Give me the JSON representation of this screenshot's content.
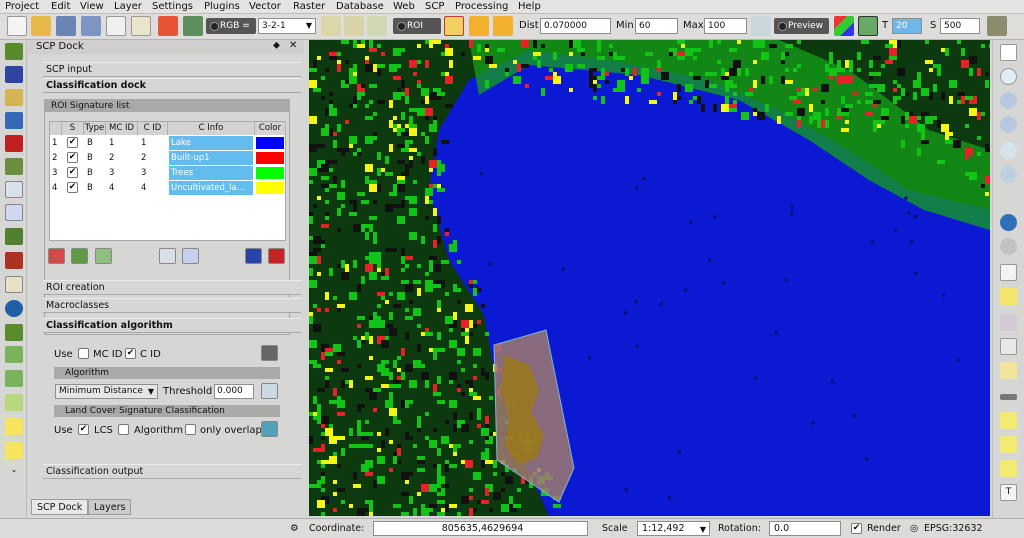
{
  "menu": [
    "Project",
    "Edit",
    "View",
    "Layer",
    "Settings",
    "Plugins",
    "Vector",
    "Raster",
    "Database",
    "Web",
    "SCP",
    "Processing",
    "Help"
  ],
  "toolbar": {
    "rgb_label": "RGB =",
    "rgb_value": "3-2-1",
    "roi_label": "ROI",
    "dist_label": "Dist",
    "dist_value": "0.070000",
    "min_label": "Min",
    "min_value": "60",
    "max_label": "Max",
    "max_value": "100",
    "preview_label": "Preview",
    "t_label": "T",
    "t_value": "20",
    "s_label": "S",
    "s_value": "500"
  },
  "dock": {
    "title": "SCP Dock",
    "scp_input": "SCP input",
    "classification_dock": "Classification dock",
    "roi_signature_list": "ROI Signature list",
    "columns": [
      "S",
      "Type",
      "MC ID",
      "C ID",
      "C Info",
      "Color"
    ],
    "rows": [
      {
        "num": "1",
        "checked": "✔",
        "type": "B",
        "mc_id": "1",
        "c_id": "1",
        "c_info": "Lake",
        "color": "#0000ff"
      },
      {
        "num": "2",
        "checked": "✔",
        "type": "B",
        "mc_id": "2",
        "c_id": "2",
        "c_info": "Built-up1",
        "color": "#ff0000"
      },
      {
        "num": "3",
        "checked": "✔",
        "type": "B",
        "mc_id": "3",
        "c_id": "3",
        "c_info": "Trees",
        "color": "#00ff00"
      },
      {
        "num": "4",
        "checked": "✔",
        "type": "B",
        "mc_id": "4",
        "c_id": "4",
        "c_info": "Uncultivated_la...",
        "color": "#ffff00"
      }
    ],
    "roi_creation": "ROI creation",
    "macroclasses": "Macroclasses",
    "classification_algorithm": "Classification algorithm",
    "use_label": "Use",
    "mc_id_label": "MC ID",
    "c_id_label": "C ID",
    "algorithm_header": "Algorithm",
    "algorithm_value": "Minimum Distance",
    "threshold_label": "Threshold",
    "threshold_value": "0.000",
    "lcs_header": "Land Cover Signature Classification",
    "use2_label": "Use",
    "lcs_label": "LCS",
    "algorithm_check_label": "Algorithm",
    "only_overlap_label": "only overlap",
    "classification_output": "Classification output"
  },
  "tabs": [
    "SCP Dock",
    "Layers"
  ],
  "status": {
    "coordinate_label": "Coordinate:",
    "coordinate_value": "805635,4629694",
    "scale_label": "Scale",
    "scale_value": "1:12,492",
    "rotation_label": "Rotation:",
    "rotation_value": "0.0",
    "render_label": "Render",
    "epsg": "EPSG:32632"
  },
  "colors": {
    "lake": "#0b1ad2",
    "built_up": "#e8202a",
    "trees": "#12c415",
    "uncultivated": "#f5f516",
    "roi_fill": "#a07a70"
  }
}
